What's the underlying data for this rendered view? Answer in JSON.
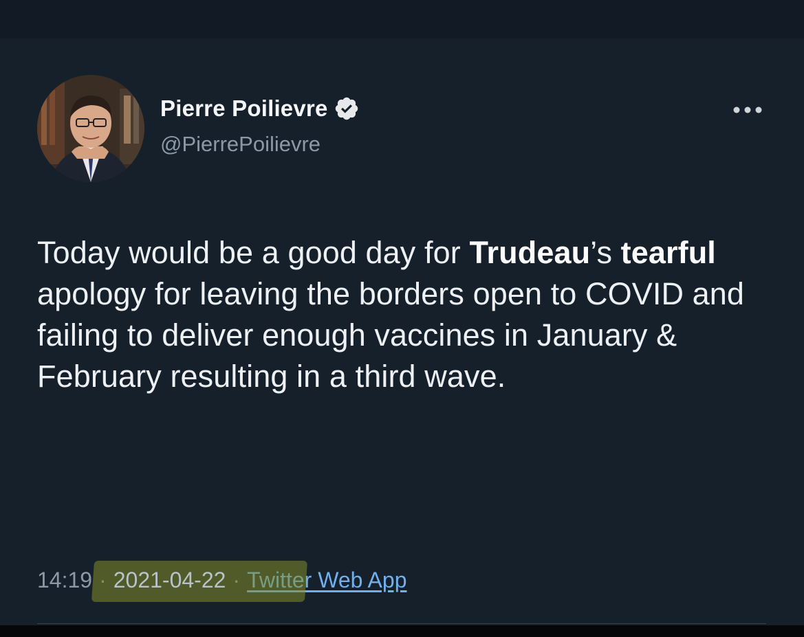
{
  "tweet": {
    "author": {
      "display_name": "Pierre Poilievre",
      "handle": "@PierrePoilievre",
      "verified": true
    },
    "more_menu_icon": "more-horizontal-icon",
    "text_segments": [
      {
        "text": "Today would be a good day for ",
        "bold": false
      },
      {
        "text": "Trudeau",
        "bold": true
      },
      {
        "text": "’s ",
        "bold": false
      },
      {
        "text": "tearful",
        "bold": true
      },
      {
        "text": " apology for leaving the borders open to COVID and failing to deliver enough vaccines in January & February resulting in a third wave.",
        "bold": false
      }
    ],
    "meta": {
      "time": "14:19",
      "separator": "·",
      "date": "2021-04-22",
      "source": "Twitter Web App"
    }
  },
  "colors": {
    "background": "#15202b",
    "text": "#eef1f4",
    "secondary_text": "#8b98a5",
    "link": "#6fb1ef",
    "highlight": "#828c28"
  }
}
